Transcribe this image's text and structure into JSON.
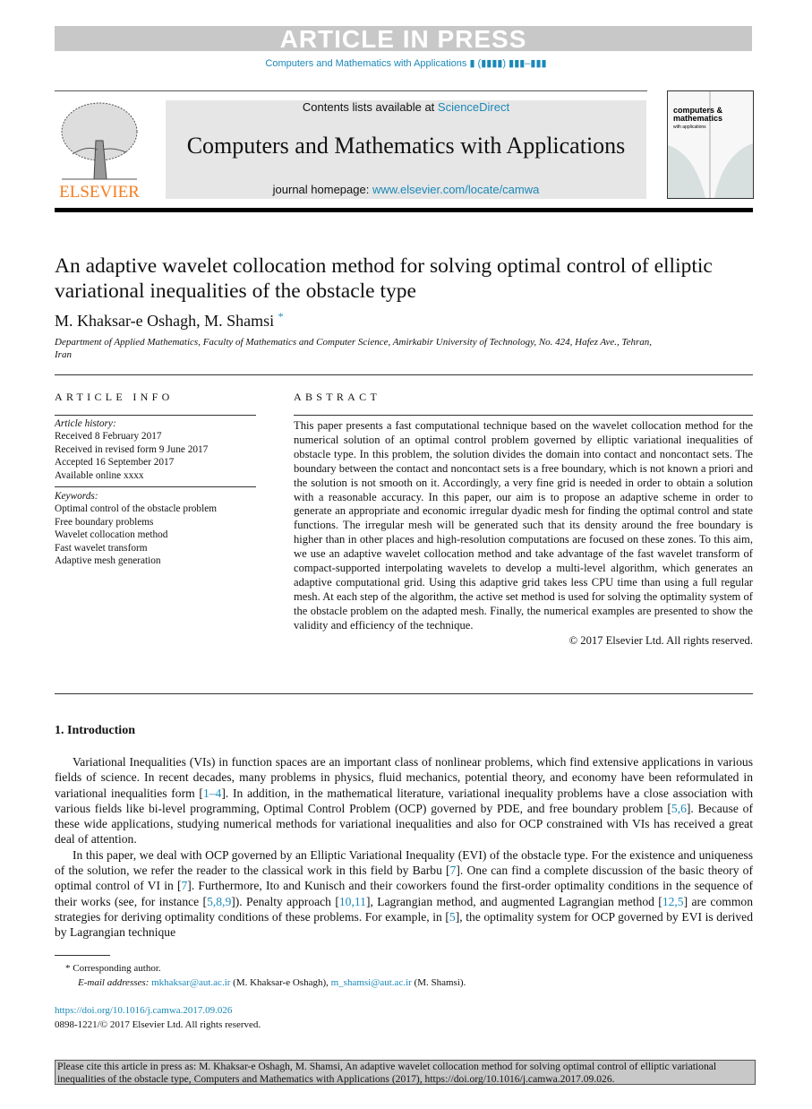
{
  "banner": "ARTICLE IN PRESS",
  "journal_ref": "Computers and Mathematics with Applications ▮ (▮▮▮▮) ▮▮▮–▮▮▮",
  "header": {
    "publisher": "ELSEVIER",
    "contents_prefix": "Contents lists available at ",
    "contents_link": "ScienceDirect",
    "journal_title": "Computers and Mathematics with Applications",
    "homepage_prefix": "journal homepage: ",
    "homepage_link": "www.elsevier.com/locate/camwa",
    "cover_text": [
      "computers &",
      "mathematics",
      "with applications"
    ]
  },
  "article": {
    "title": "An adaptive wavelet collocation method for solving optimal control of elliptic variational inequalities of the obstacle type",
    "authors": "M. Khaksar-e Oshagh, M. Shamsi",
    "author_mark": "*",
    "affiliation": "Department of Applied Mathematics, Faculty of Mathematics and Computer Science, Amirkabir University of Technology, No. 424, Hafez Ave., Tehran, Iran"
  },
  "article_info": {
    "heading": "ARTICLE INFO",
    "history_label": "Article history:",
    "history": [
      "Received 8 February 2017",
      "Received in revised form 9 June 2017",
      "Accepted 16 September 2017",
      "Available online xxxx"
    ],
    "keywords_label": "Keywords:",
    "keywords": [
      "Optimal control of the obstacle problem",
      "Free boundary problems",
      "Wavelet collocation method",
      "Fast wavelet transform",
      "Adaptive mesh generation"
    ]
  },
  "abstract": {
    "heading": "ABSTRACT",
    "text": "This paper presents a fast computational technique based on the wavelet collocation method for the numerical solution of an optimal control problem governed by elliptic variational inequalities of obstacle type. In this problem, the solution divides the domain into contact and noncontact sets. The boundary between the contact and noncontact sets is a free boundary, which is not known a priori and the solution is not smooth on it. Accordingly, a very fine grid is needed in order to obtain a solution with a reasonable accuracy. In this paper, our aim is to propose an adaptive scheme in order to generate an appropriate and economic irregular dyadic mesh for finding the optimal control and state functions. The irregular mesh will be generated such that its density around the free boundary is higher than in other places and high-resolution computations are focused on these zones. To this aim, we use an adaptive wavelet collocation method and take advantage of the fast wavelet transform of compact-supported interpolating wavelets to develop a multi-level algorithm, which generates an adaptive computational grid. Using this adaptive grid takes less CPU time than using a full regular mesh. At each step of the algorithm, the active set method is used for solving the optimality system of the obstacle problem on the adapted mesh. Finally, the numerical examples are presented to show the validity and efficiency of the technique.",
    "copyright": "© 2017 Elsevier Ltd. All rights reserved."
  },
  "intro": {
    "heading": "1.  Introduction",
    "paragraphs": [
      [
        {
          "t": "Variational Inequalities (VIs) in function spaces are an important class of nonlinear problems, which find extensive applications in various fields of science. In recent decades, many problems in physics, fluid mechanics, potential theory, and economy have been reformulated in variational inequalities form ["
        },
        {
          "t": "1–4",
          "link": true
        },
        {
          "t": "]. In addition, in the mathematical literature, variational inequality problems have a close association with various fields like bi-level programming, Optimal Control Problem (OCP) governed by PDE, and free boundary problem ["
        },
        {
          "t": "5,6",
          "link": true
        },
        {
          "t": "]. Because of these wide applications, studying numerical methods for variational inequalities and also for OCP constrained with VIs has received a great deal of attention."
        }
      ],
      [
        {
          "t": "In this paper, we deal with OCP governed by an Elliptic Variational Inequality (EVI) of the obstacle type. For the existence and uniqueness of the solution, we refer the reader to the classical work in this field by Barbu ["
        },
        {
          "t": "7",
          "link": true
        },
        {
          "t": "]. One can find a complete discussion of the basic theory of optimal control of VI in ["
        },
        {
          "t": "7",
          "link": true
        },
        {
          "t": "]. Furthermore, Ito and Kunisch and their coworkers found the first-order optimality conditions in the sequence of their works (see, for instance ["
        },
        {
          "t": "5,8,9",
          "link": true
        },
        {
          "t": "]). Penalty approach ["
        },
        {
          "t": "10,11",
          "link": true
        },
        {
          "t": "], Lagrangian method, and augmented Lagrangian method ["
        },
        {
          "t": "12,5",
          "link": true
        },
        {
          "t": "] are common strategies for deriving optimality conditions of these problems. For example, in ["
        },
        {
          "t": "5",
          "link": true
        },
        {
          "t": "], the optimality system for OCP governed by EVI is derived by Lagrangian technique"
        }
      ]
    ]
  },
  "footnote": {
    "mark": "*",
    "corresponding": "Corresponding author.",
    "email_label": "E-mail addresses: ",
    "email1": "mkhaksar@aut.ac.ir",
    "name1": " (M. Khaksar-e Oshagh), ",
    "email2": "m_shamsi@aut.ac.ir",
    "name2": " (M. Shamsi)."
  },
  "doi": {
    "link": "https://doi.org/10.1016/j.camwa.2017.09.026",
    "issn": "0898-1221/© 2017 Elsevier Ltd. All rights reserved."
  },
  "citation_box": "Please cite this article in press as: M. Khaksar-e Oshagh, M. Shamsi, An adaptive wavelet collocation method for solving optimal control of elliptic variational inequalities of the obstacle type, Computers and Mathematics with Applications (2017), https://doi.org/10.1016/j.camwa.2017.09.026.",
  "colors": {
    "link": "#1a88b8",
    "publisher": "#f47d20",
    "banner": "#c8c8c8"
  }
}
